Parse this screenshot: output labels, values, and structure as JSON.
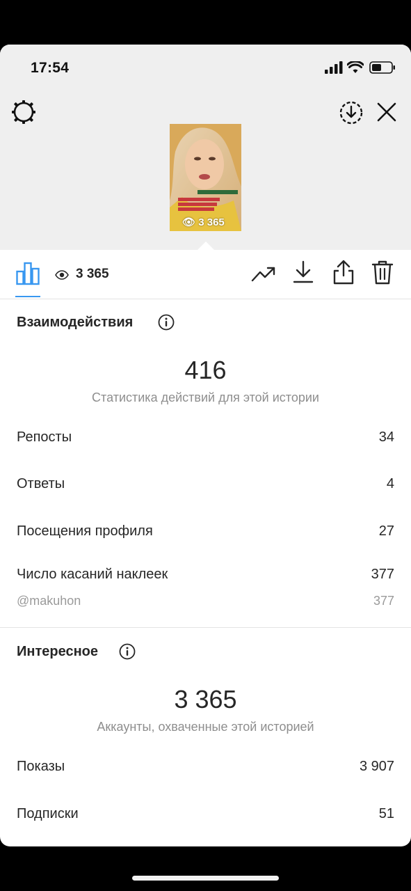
{
  "status_bar": {
    "time": "17:54"
  },
  "story": {
    "views_overlay": "3 365"
  },
  "toolbar": {
    "views": "3 365"
  },
  "interactions": {
    "title": "Взаимодействия",
    "total": "416",
    "subtitle": "Статистика действий для этой истории",
    "rows": [
      {
        "label": "Репосты",
        "value": "34"
      },
      {
        "label": "Ответы",
        "value": "4"
      },
      {
        "label": "Посещения профиля",
        "value": "27"
      },
      {
        "label": "Число касаний наклеек",
        "value": "377"
      }
    ],
    "sticker": {
      "label": "@makuhon",
      "value": "377"
    }
  },
  "discovery": {
    "title": "Интересное",
    "total": "3 365",
    "subtitle": "Аккаунты, охваченные этой историей",
    "rows": [
      {
        "label": "Показы",
        "value": "3 907"
      },
      {
        "label": "Подписки",
        "value": "51"
      }
    ]
  },
  "colors": {
    "accent": "#3897f0",
    "text": "#262626",
    "muted": "#8e8e8e"
  }
}
